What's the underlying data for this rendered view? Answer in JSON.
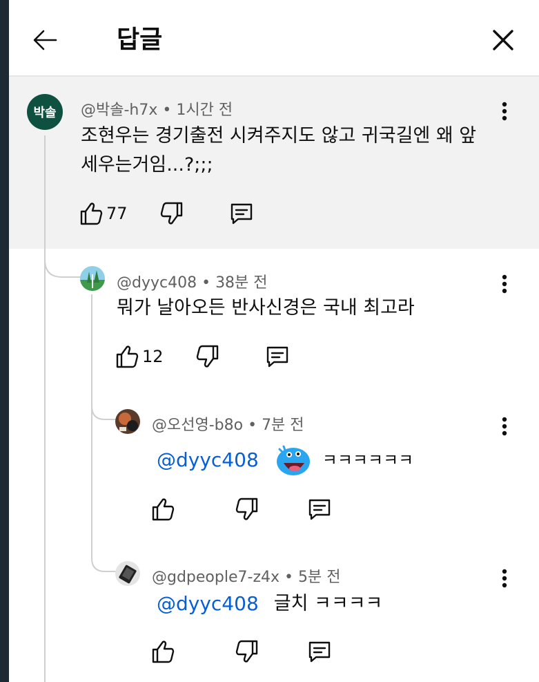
{
  "header": {
    "title": "답글"
  },
  "parent": {
    "avatar_text": "박솔",
    "author": "@박솔-h7x",
    "time": "1시간 전",
    "text": "조현우는 경기출전 시켜주지도 않고 귀국길엔 왜 앞세우는거임...?;;;",
    "likes": "77"
  },
  "reply1": {
    "author": "@dyyc408",
    "time": "38분 전",
    "text": "뭐가 날아오든 반사신경은 국내 최고라",
    "likes": "12"
  },
  "reply2": {
    "author": "@오선영-b8o",
    "time": "7분 전",
    "mention": "@dyyc408",
    "text": "ㅋㅋㅋㅋㅋㅋ"
  },
  "reply3": {
    "author": "@gdpeople7-z4x",
    "time": "5분 전",
    "mention": "@dyyc408",
    "text": "글치 ㅋㅋㅋㅋ"
  },
  "colors": {
    "accent": "#065fd4",
    "parent_bg": "#f2f2f2",
    "avatar_bg": "#0f5140"
  },
  "icons": [
    "back-arrow-icon",
    "close-icon",
    "more-vert-icon",
    "thumb-up-icon",
    "thumb-down-icon",
    "reply-icon",
    "emoji-sticker-icon"
  ]
}
